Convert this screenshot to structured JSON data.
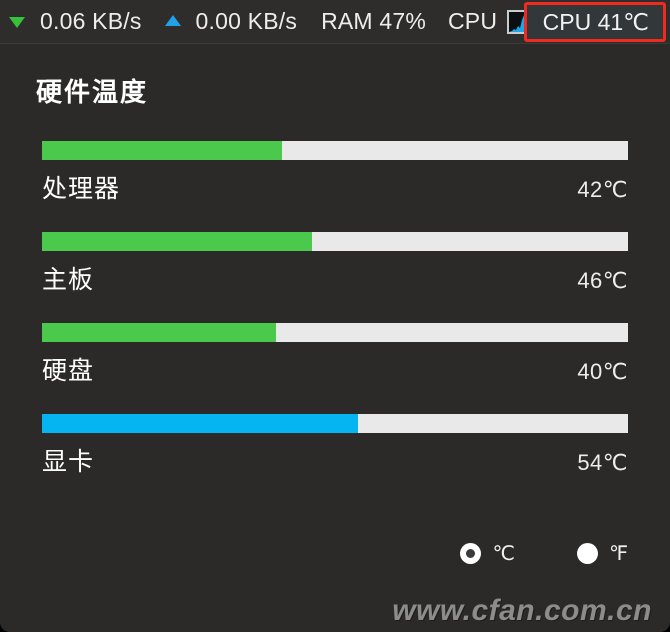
{
  "topbar": {
    "download_icon": "arrow-down-icon",
    "download_speed": "0.06 KB/s",
    "upload_icon": "arrow-up-icon",
    "upload_speed": "0.00 KB/s",
    "ram_label": "RAM 47%",
    "cpu_label": "CPU",
    "cpu_graph_icon": "cpu-activity-graph-icon",
    "cpu_temp": "CPU 41℃",
    "highlight_color": "#ef2a1f"
  },
  "panel": {
    "title": "硬件温度",
    "rows": [
      {
        "name": "处理器",
        "value": "42℃",
        "percent": 41,
        "color": "#4ac94d"
      },
      {
        "name": "主板",
        "value": "46℃",
        "percent": 46,
        "color": "#4ac94d"
      },
      {
        "name": "硬盘",
        "value": "40℃",
        "percent": 40,
        "color": "#4ac94d"
      },
      {
        "name": "显卡",
        "value": "54℃",
        "percent": 54,
        "color": "#05b5f2"
      }
    ],
    "units": [
      {
        "label": "℃",
        "selected": true
      },
      {
        "label": "℉",
        "selected": false
      }
    ]
  },
  "watermark": "www.cfan.com.cn"
}
